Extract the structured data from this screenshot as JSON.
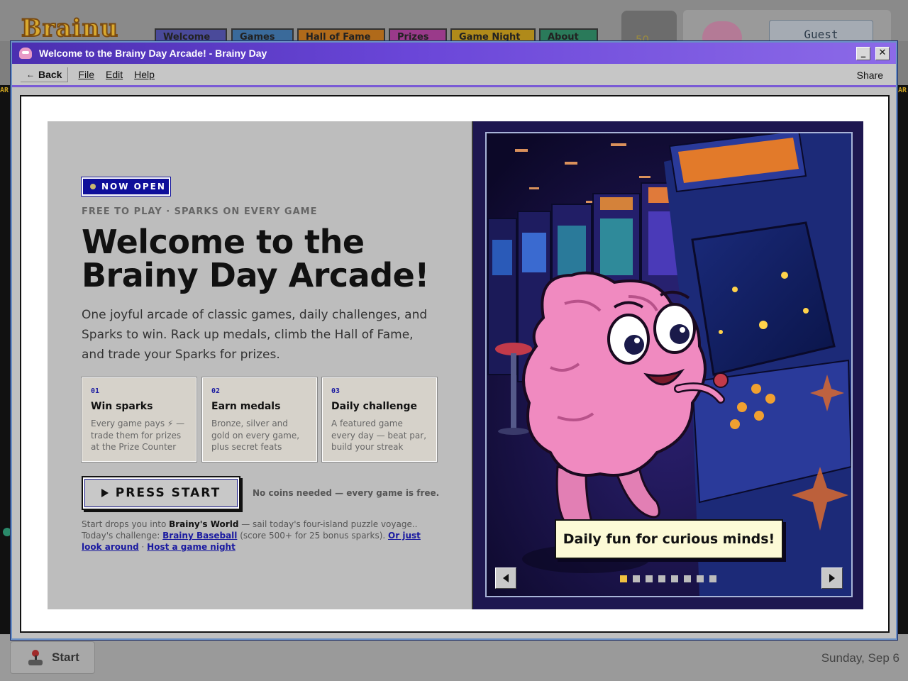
{
  "background": {
    "logo": "Brainu",
    "tabs": [
      "Welcome",
      "Games",
      "Hall of Fame",
      "Prizes",
      "Game Night",
      "About"
    ],
    "sparks": "50",
    "guest": "Guest",
    "strip": "AR"
  },
  "window": {
    "title": "Welcome to the Brainy Day Arcade! - Brainy Day",
    "minimize": "_",
    "close": "✕"
  },
  "menubar": {
    "back": "Back",
    "file": "File",
    "edit": "Edit",
    "help": "Help",
    "share": "Share"
  },
  "hero": {
    "badge": "NOW OPEN",
    "eyebrow": "FREE TO PLAY · SPARKS ON EVERY GAME",
    "headline_line1": "Welcome to the",
    "headline_line2": "Brainy Day Arcade!",
    "intro": "One joyful arcade of classic games, daily challenges, and Sparks to win. Rack up medals, climb the Hall of Fame, and trade your Sparks for prizes.",
    "cards": [
      {
        "num": "01",
        "title": "Win sparks",
        "desc": "Every game pays ⚡ — trade them for prizes at the Prize Counter"
      },
      {
        "num": "02",
        "title": "Earn medals",
        "desc": "Bronze, silver and gold on every game, plus secret feats"
      },
      {
        "num": "03",
        "title": "Daily challenge",
        "desc": "A featured game every day — beat par, build your streak"
      }
    ],
    "cta": "PRESS START",
    "no_coins": "No coins needed — every game is free.",
    "footnote": {
      "p1": "Start drops you into ",
      "world": "Brainy's World",
      "p2": " — sail today's four-island puzzle voyage.. Today's challenge: ",
      "link1": "Brainy Baseball",
      "p3": " (score 500+ for 25 bonus sparks). ",
      "link2": "Or just look around",
      "p4": " · ",
      "link3": "Host a game night"
    }
  },
  "carousel": {
    "caption": "Daily fun for curious minds!",
    "slide_count": 8,
    "active_slide": 1
  },
  "taskbar": {
    "start": "Start",
    "date": "Sunday, Sep 6"
  },
  "colors": {
    "title_gradient_start": "#4b2fb0",
    "accent": "#7a5ad6",
    "link": "#1a1aa0",
    "badge": "#0f0f9a",
    "caption_bg": "#fcfad6",
    "active_dot": "#f0c040"
  }
}
